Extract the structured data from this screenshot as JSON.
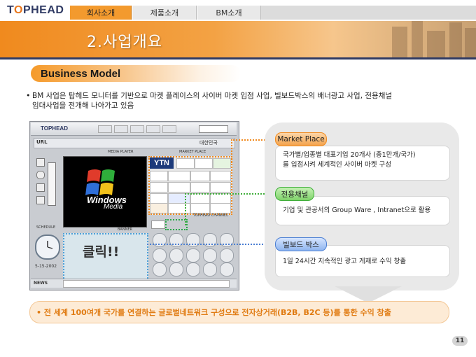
{
  "header": {
    "logo_prefix": "T",
    "logo_o": "O",
    "logo_suffix": "PHEAD",
    "tabs": [
      {
        "label": "회사소개"
      },
      {
        "label": "제품소개"
      },
      {
        "label": "BM소개"
      }
    ]
  },
  "page_title": "2.사업개요",
  "section": {
    "title": "Business Model",
    "bullet": "•",
    "description_line1": "BM 사업은 탑헤드 모니터를 기반으로  마켓 플레이스의 사이버 마켓 입점 사업, 빌보드박스의 배너광고 사업, 전용채널",
    "description_line2": "임대사업을 전개해 나아가고 있음"
  },
  "browser": {
    "logo": "TOPHEAD",
    "url_label": "URL",
    "media_player_label": "MEDIA PLAYER",
    "market_place_label": "MARKET PLACE",
    "banner_label": "BANNER",
    "tophead_channel_label": "TOPHEAD CHANNEL",
    "schedule_label": "SCHEDULE",
    "windows_text": "Windows",
    "media_text": "Media",
    "click_text": "클릭!!",
    "date_text": "5-15-2002",
    "news_label": "NEWS",
    "ytn_label": "YTN",
    "region_label": "대한민국"
  },
  "panel": {
    "items": [
      {
        "pill": "Market Place",
        "text_line1": "국가별/업종별 대표기업 20개사 (총1만개/국가)",
        "text_line2": "를 입점시켜 세계적인 사이버 마켓 구성"
      },
      {
        "pill": "전용채널",
        "text_line1": "기업 및 관공서의 Group Ware , Intranet으로 활용",
        "text_line2": ""
      },
      {
        "pill": "빌보드 박스",
        "text_line1": "1일 24시간 지속적인 광고 게재로 수익 창출",
        "text_line2": ""
      }
    ]
  },
  "bottom_note": "• 전 세계 100여개 국가를 연결하는 글로벌네트워크 구성으로  전자상거래(B2B, B2C 등)를 통한 수익 창출",
  "page_number": "11",
  "colors": {
    "accent_orange": "#f08a1e",
    "navy": "#2f3a63",
    "green": "#3fae3a",
    "blue": "#4b7fd3"
  }
}
